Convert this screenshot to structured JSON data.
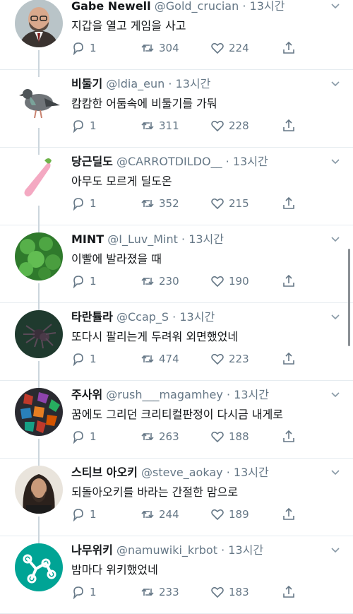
{
  "tweets": [
    {
      "name": "Gabe Newell",
      "handle": "@Gold_crucian",
      "time": "13시간",
      "text": "지갑을 열고 게임을 사고",
      "replies": "1",
      "retweets": "304",
      "likes": "224",
      "avatar": "person-suit"
    },
    {
      "name": "비둘기",
      "handle": "@ldia_eun",
      "time": "13시간",
      "text": "캄캄한 어둠속에 비둘기를 가둬",
      "replies": "1",
      "retweets": "311",
      "likes": "228",
      "avatar": "pigeon"
    },
    {
      "name": "당근딜도",
      "handle": "@CARROTDILDO__",
      "time": "13시간",
      "text": "아무도 모르게 딜도온",
      "replies": "1",
      "retweets": "352",
      "likes": "215",
      "avatar": "carrot"
    },
    {
      "name": "MINT",
      "handle": "@I_Luv_Mint",
      "time": "13시간",
      "text": "이빨에 발라졌을 때",
      "replies": "1",
      "retweets": "230",
      "likes": "190",
      "avatar": "mint-leaves"
    },
    {
      "name": "타란튤라",
      "handle": "@Ccap_S",
      "time": "13시간",
      "text": "또다시 팔리는게 두려워 외면했었네",
      "replies": "1",
      "retweets": "474",
      "likes": "223",
      "avatar": "tarantula"
    },
    {
      "name": "주사위",
      "handle": "@rush___magamhey",
      "time": "13시간",
      "text": "꿈에도 그리던 크리티컬판정이 다시금 내게로",
      "replies": "1",
      "retweets": "263",
      "likes": "188",
      "avatar": "dice"
    },
    {
      "name": "스티브 아오키",
      "handle": "@steve_aokay",
      "time": "13시간",
      "text": "되돌아오키를 바라는 간절한 맘으로",
      "replies": "1",
      "retweets": "244",
      "likes": "189",
      "avatar": "long-hair-man"
    },
    {
      "name": "나무위키",
      "handle": "@namuwiki_krbot",
      "time": "13시간",
      "text": "밤마다 위키했었네",
      "replies": "1",
      "retweets": "233",
      "likes": "183",
      "avatar": "namuwiki-logo"
    }
  ],
  "separator": "·",
  "colors": {
    "muted": "#657786",
    "text": "#14171a",
    "border": "#e6ecf0",
    "namuwiki": "#00a495"
  }
}
